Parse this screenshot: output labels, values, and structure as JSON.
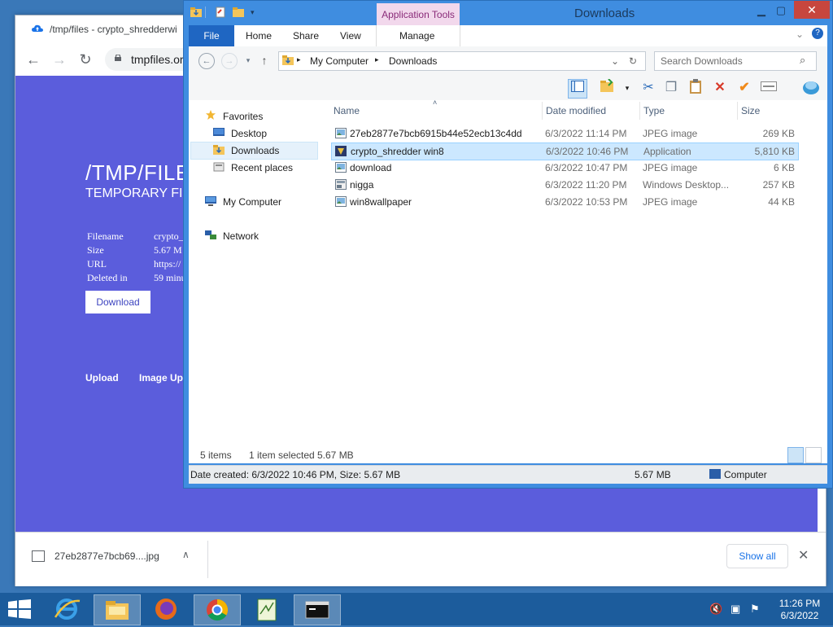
{
  "browser": {
    "tab_title": "/tmp/files - crypto_shredderwi",
    "url": "tmpfiles.or",
    "page": {
      "heading": "/TMP/FILE",
      "subheading": "TEMPORARY FI",
      "meta_labels": [
        "Filename",
        "Size",
        "URL",
        "Deleted in"
      ],
      "meta_values": [
        "crypto_",
        "5.67 M",
        "https://",
        "59 minu"
      ],
      "download_label": "Download",
      "links": [
        "Upload",
        "Image Upl"
      ]
    },
    "download_bar": {
      "file_name": "27eb2877e7bcb69....jpg",
      "show_all_label": "Show all",
      "close_symbol": "✕"
    }
  },
  "explorer": {
    "title": "Downloads",
    "context_tab": "Application Tools",
    "ribbon_tabs": [
      "File",
      "Home",
      "Share",
      "View",
      "Manage"
    ],
    "address": [
      "My Computer",
      "Downloads"
    ],
    "search_placeholder": "Search Downloads",
    "nav": {
      "favorites": "Favorites",
      "desktop": "Desktop",
      "downloads": "Downloads",
      "recent": "Recent places",
      "computer": "My Computer",
      "network": "Network"
    },
    "columns": [
      "Name",
      "Date modified",
      "Type",
      "Size"
    ],
    "files": [
      {
        "name": "27eb2877e7bcb6915b44e52ecb13c4dd",
        "date": "6/3/2022 11:14 PM",
        "type": "JPEG image",
        "size": "269 KB",
        "icon": "image-icon"
      },
      {
        "name": "crypto_shredder win8",
        "date": "6/3/2022 10:46 PM",
        "type": "Application",
        "size": "5,810 KB",
        "icon": "app-icon"
      },
      {
        "name": "download",
        "date": "6/3/2022 10:47 PM",
        "type": "JPEG image",
        "size": "6 KB",
        "icon": "image-icon"
      },
      {
        "name": "nigga",
        "date": "6/3/2022 11:20 PM",
        "type": "Windows Desktop...",
        "size": "257 KB",
        "icon": "theme-icon"
      },
      {
        "name": "win8wallpaper",
        "date": "6/3/2022 10:53 PM",
        "type": "JPEG image",
        "size": "44 KB",
        "icon": "image-icon"
      }
    ],
    "status": {
      "items": "5 items",
      "selected": "1 item selected",
      "selected_size": "5.67 MB"
    },
    "details": {
      "info": "Date created: 6/3/2022 10:46 PM, Size: 5.67 MB",
      "size": "5.67 MB",
      "location": "Computer"
    }
  },
  "taskbar": {
    "time": "11:26 PM",
    "date": "6/3/2022"
  },
  "colors": {
    "page_bg": "#5b5ddc",
    "explorer_frame": "#3f8de0",
    "taskbar": "#1c5c9c",
    "selection": "#cce8ff"
  }
}
